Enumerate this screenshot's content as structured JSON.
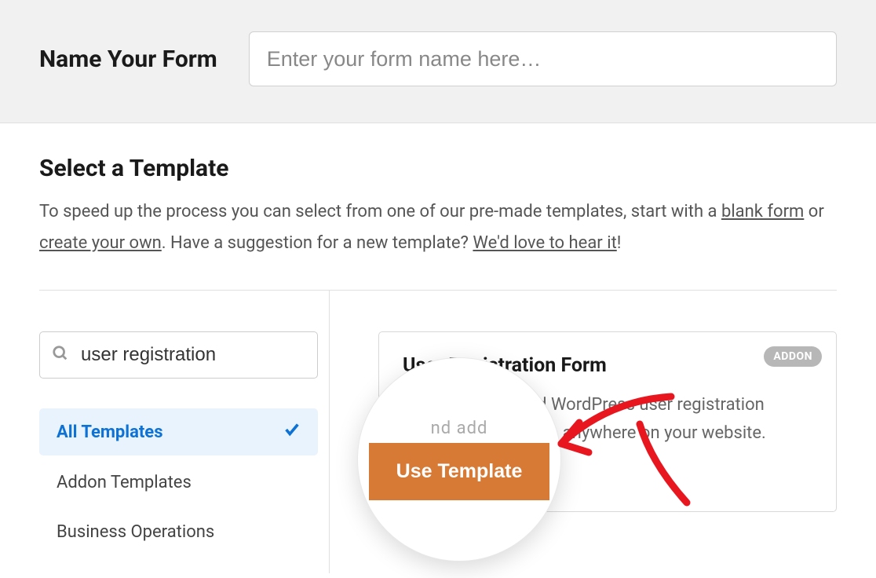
{
  "header": {
    "label": "Name Your Form",
    "placeholder": "Enter your form name here…"
  },
  "template_section": {
    "title": "Select a Template",
    "desc_pre": "To speed up the process you can select from one of our pre-made templates, start with a ",
    "link_blank": "blank form",
    "desc_mid": " or ",
    "link_create": "create your own",
    "desc_mid2": ". Have a suggestion for a new template? ",
    "link_suggest": "We'd love to hear it",
    "desc_end": "!"
  },
  "search": {
    "value": "user registration"
  },
  "categories": [
    {
      "label": "All Templates",
      "active": true
    },
    {
      "label": "Addon Templates",
      "active": false
    },
    {
      "label": "Business Operations",
      "active": false
    }
  ],
  "card": {
    "badge": "ADDON",
    "title": "User Registration Form",
    "description": "Create customized WordPress user registration forms and add them anywhere on your website."
  },
  "magnifier": {
    "faded_text": "nd add",
    "button_label": "Use Template"
  }
}
